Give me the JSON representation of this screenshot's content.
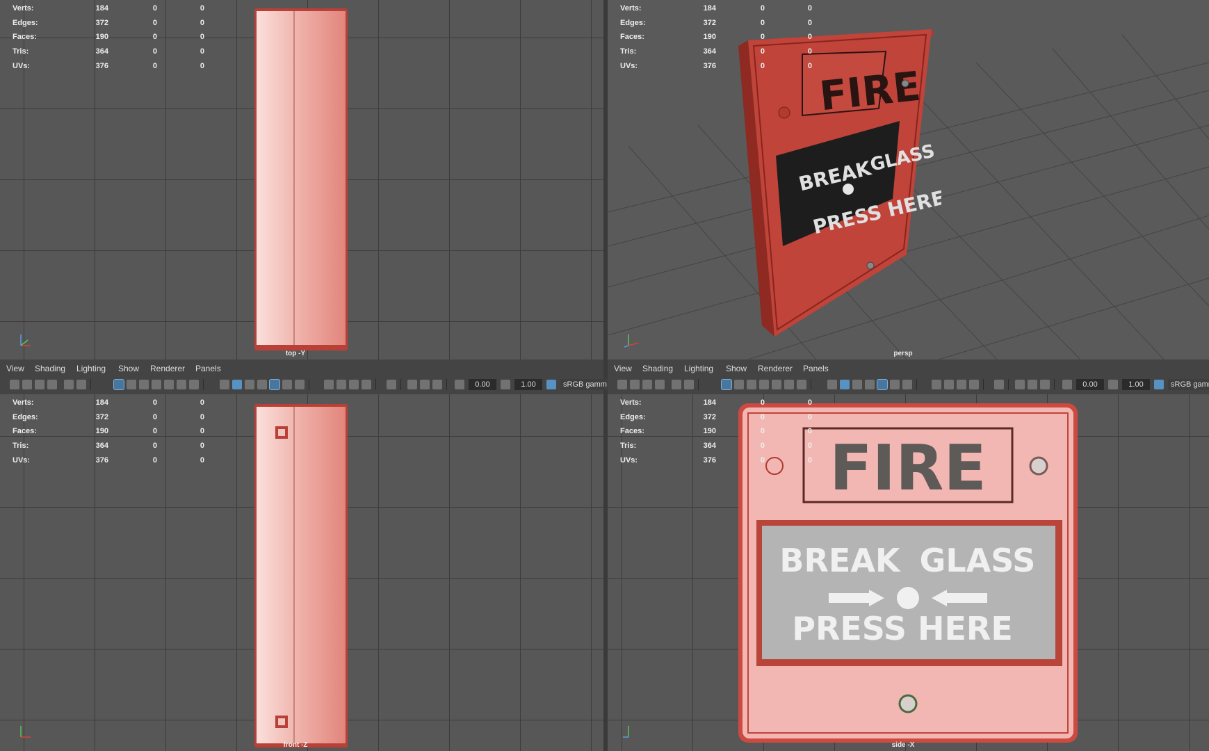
{
  "stats": {
    "rows": [
      {
        "label": "Verts:",
        "v1": "184",
        "v2": "0",
        "v3": "0"
      },
      {
        "label": "Edges:",
        "v1": "372",
        "v2": "0",
        "v3": "0"
      },
      {
        "label": "Faces:",
        "v1": "190",
        "v2": "0",
        "v3": "0"
      },
      {
        "label": "Tris:",
        "v1": "364",
        "v2": "0",
        "v3": "0"
      },
      {
        "label": "UVs:",
        "v1": "376",
        "v2": "0",
        "v3": "0"
      }
    ]
  },
  "viewports": {
    "top_left": {
      "camera": "top -Y"
    },
    "top_right": {
      "camera": "persp"
    },
    "bottom_left": {
      "camera": "front -Z"
    },
    "bottom_right": {
      "camera": "side -X"
    }
  },
  "menu": {
    "items": [
      "View",
      "Shading",
      "Lighting",
      "Show",
      "Renderer",
      "Panels"
    ]
  },
  "toolbar": {
    "exposure": "0.00",
    "gamma": "1.00",
    "color_space": "sRGB gamm"
  },
  "model_text": {
    "fire": "FIRE",
    "break": "BREAK",
    "glass": "GLASS",
    "press": "PRESS HERE"
  },
  "axis": {
    "x": "x",
    "y": "y",
    "z": "z"
  },
  "colors": {
    "viewport_bg": "#575757",
    "grid": "#3c3c3c",
    "model_red": "#c0443a",
    "model_pink": "#f2b7b2",
    "toolbar_blue": "#5aa0d8"
  }
}
